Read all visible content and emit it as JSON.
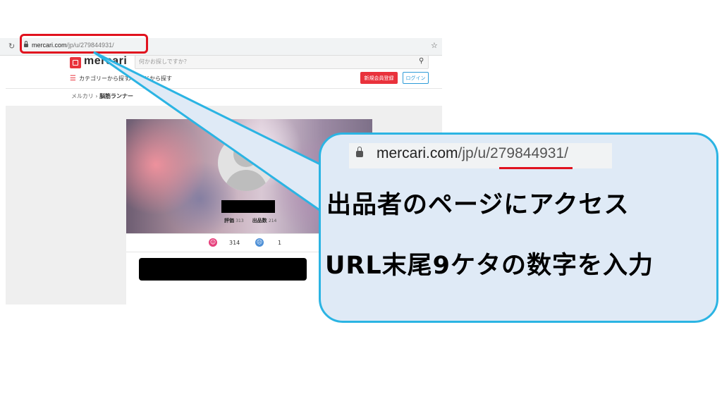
{
  "browser": {
    "reload_icon": "↻",
    "url_host": "mercari.com",
    "url_path": "/jp/u/279844931/",
    "bookmark_icon": "☆"
  },
  "site": {
    "logo_text": "mercari",
    "search_placeholder": "何かお探しですか？",
    "search_icon": "🔍",
    "category_link": "カテゴリーから探す",
    "brand_link": "ブランドから探す",
    "register_button": "新規会員登録",
    "login_button": "ログイン",
    "breadcrumb_home": "メルカリ",
    "breadcrumb_sep": "›",
    "breadcrumb_current": "脳筋ランナー"
  },
  "profile": {
    "rating_label": "評価",
    "rating_value": "313",
    "listings_label": "出品数",
    "listings_value": "214",
    "good_count": "314",
    "bad_count": "1"
  },
  "callout": {
    "url_host": "mercari.com",
    "url_path": "/jp/u/",
    "url_id": "279844931",
    "url_end": "/",
    "line1": "出品者のページにアクセス",
    "line2": "URL末尾9ケタの数字を入力"
  },
  "colors": {
    "highlight_red": "#e1121e",
    "callout_border": "#2bb4e3",
    "callout_fill": "#dfeaf6"
  }
}
